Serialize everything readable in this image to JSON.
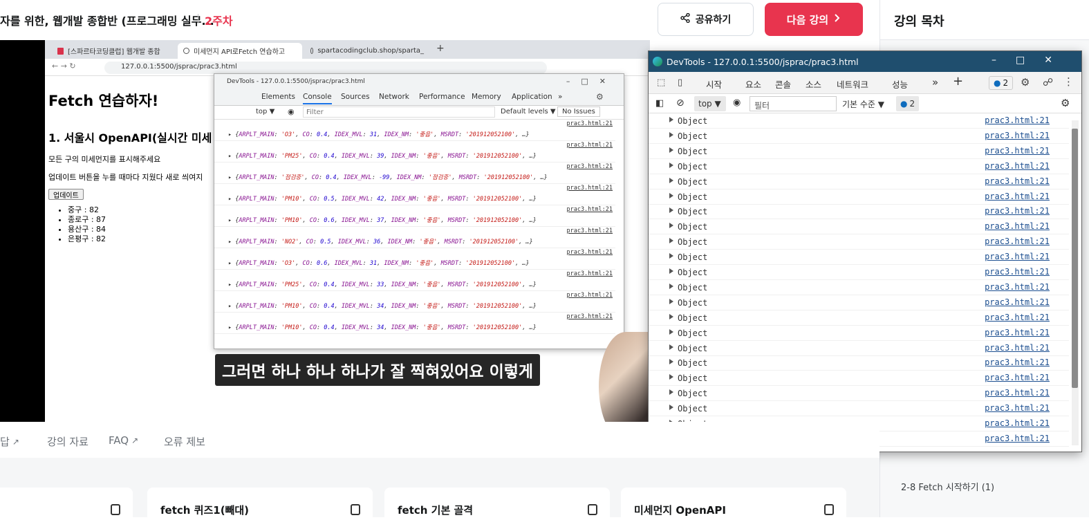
{
  "header": {
    "course_title": "자를 위한, 웹개발 종합반 (프로그래밍 실무...",
    "week": "2주차",
    "share_label": "공유하기",
    "next_label": "다음 강의",
    "icons": {
      "share": "share-icon",
      "next": "chevron-right-icon"
    }
  },
  "sidebar": {
    "title": "강의 목차",
    "item": "2-8  Fetch 시작하기 (1)"
  },
  "video": {
    "subtitle": "그러면 하나 하나 하나가 잘 찍혀있어요 이렇게",
    "progress_fraction": 0.72,
    "inner_browser": {
      "tabs": [
        "[스파르타코딩클럽] 웹개발 종합",
        "미세먼지 API로Fetch 연습하고",
        "spartacodingclub.shop/sparta_"
      ],
      "url": "127.0.0.1:5500/jsprac/prac3.html",
      "page": {
        "h1": "Fetch 연습하자!",
        "h2": "1. 서울시 OpenAPI(실시간 미세",
        "p1": "모든 구의 미세먼지를 표시해주세요",
        "p2": "업데이트 버튼을 누를 때마다 지웠다 새로 씌여지",
        "button": "업데이트",
        "list": [
          "중구 : 82",
          "종로구 : 87",
          "용산구 : 84",
          "은평구 : 82"
        ]
      },
      "devtools": {
        "title": "DevTools - 127.0.0.1:5500/jsprac/prac3.html",
        "tabs": [
          "Elements",
          "Console",
          "Sources",
          "Network",
          "Performance",
          "Memory",
          "Application",
          "»"
        ],
        "context": "top ▼",
        "filter_placeholder": "Filter",
        "levels": "Default levels ▼",
        "issues": "No Issues",
        "source": "prac3.html:21",
        "rows": [
          {
            "main": "'O3'",
            "co": "0.4",
            "mvl": "31",
            "nm": "'좋음'"
          },
          {
            "main": "'PM25'",
            "co": "0.4",
            "mvl": "39",
            "nm": "'좋음'"
          },
          {
            "main": "'점검중'",
            "co": "0.4",
            "mvl": "-99",
            "nm": "'점검중'"
          },
          {
            "main": "'PM10'",
            "co": "0.5",
            "mvl": "42",
            "nm": "'좋음'"
          },
          {
            "main": "'PM10'",
            "co": "0.6",
            "mvl": "37",
            "nm": "'좋음'"
          },
          {
            "main": "'NO2'",
            "co": "0.5",
            "mvl": "36",
            "nm": "'좋음'"
          },
          {
            "main": "'O3'",
            "co": "0.6",
            "mvl": "31",
            "nm": "'좋음'"
          },
          {
            "main": "'PM25'",
            "co": "0.4",
            "mvl": "33",
            "nm": "'좋음'"
          },
          {
            "main": "'PM10'",
            "co": "0.4",
            "mvl": "34",
            "nm": "'좋음'"
          },
          {
            "main": "'PM10'",
            "co": "0.4",
            "mvl": "34",
            "nm": "'좋음'"
          }
        ],
        "msrdt": "'201912052100'"
      }
    }
  },
  "devtools_large": {
    "title": "DevTools - 127.0.0.1:5500/jsprac/prac3.html",
    "tabs": [
      "시작",
      "요소",
      "콘솔",
      "소스",
      "네트워크",
      "성능",
      "»",
      "+"
    ],
    "issues_badge": "2",
    "context": "top",
    "filter_placeholder": "필터",
    "levels": "기본 수준",
    "issues_count": "2",
    "row_label": "Object",
    "row_source": "prac3.html:21",
    "row_count": 22
  },
  "bottom_tabs": [
    "답",
    "강의 자료",
    "FAQ",
    "오류 제보"
  ],
  "cards": [
    "fetch 퀴즈1(빼대)",
    "fetch 기본 골격",
    "미세먼지 OpenAPI"
  ],
  "colors": {
    "accent": "#e8344e",
    "devtools_title": "#1f4e6e",
    "link": "#1a4d8f"
  }
}
